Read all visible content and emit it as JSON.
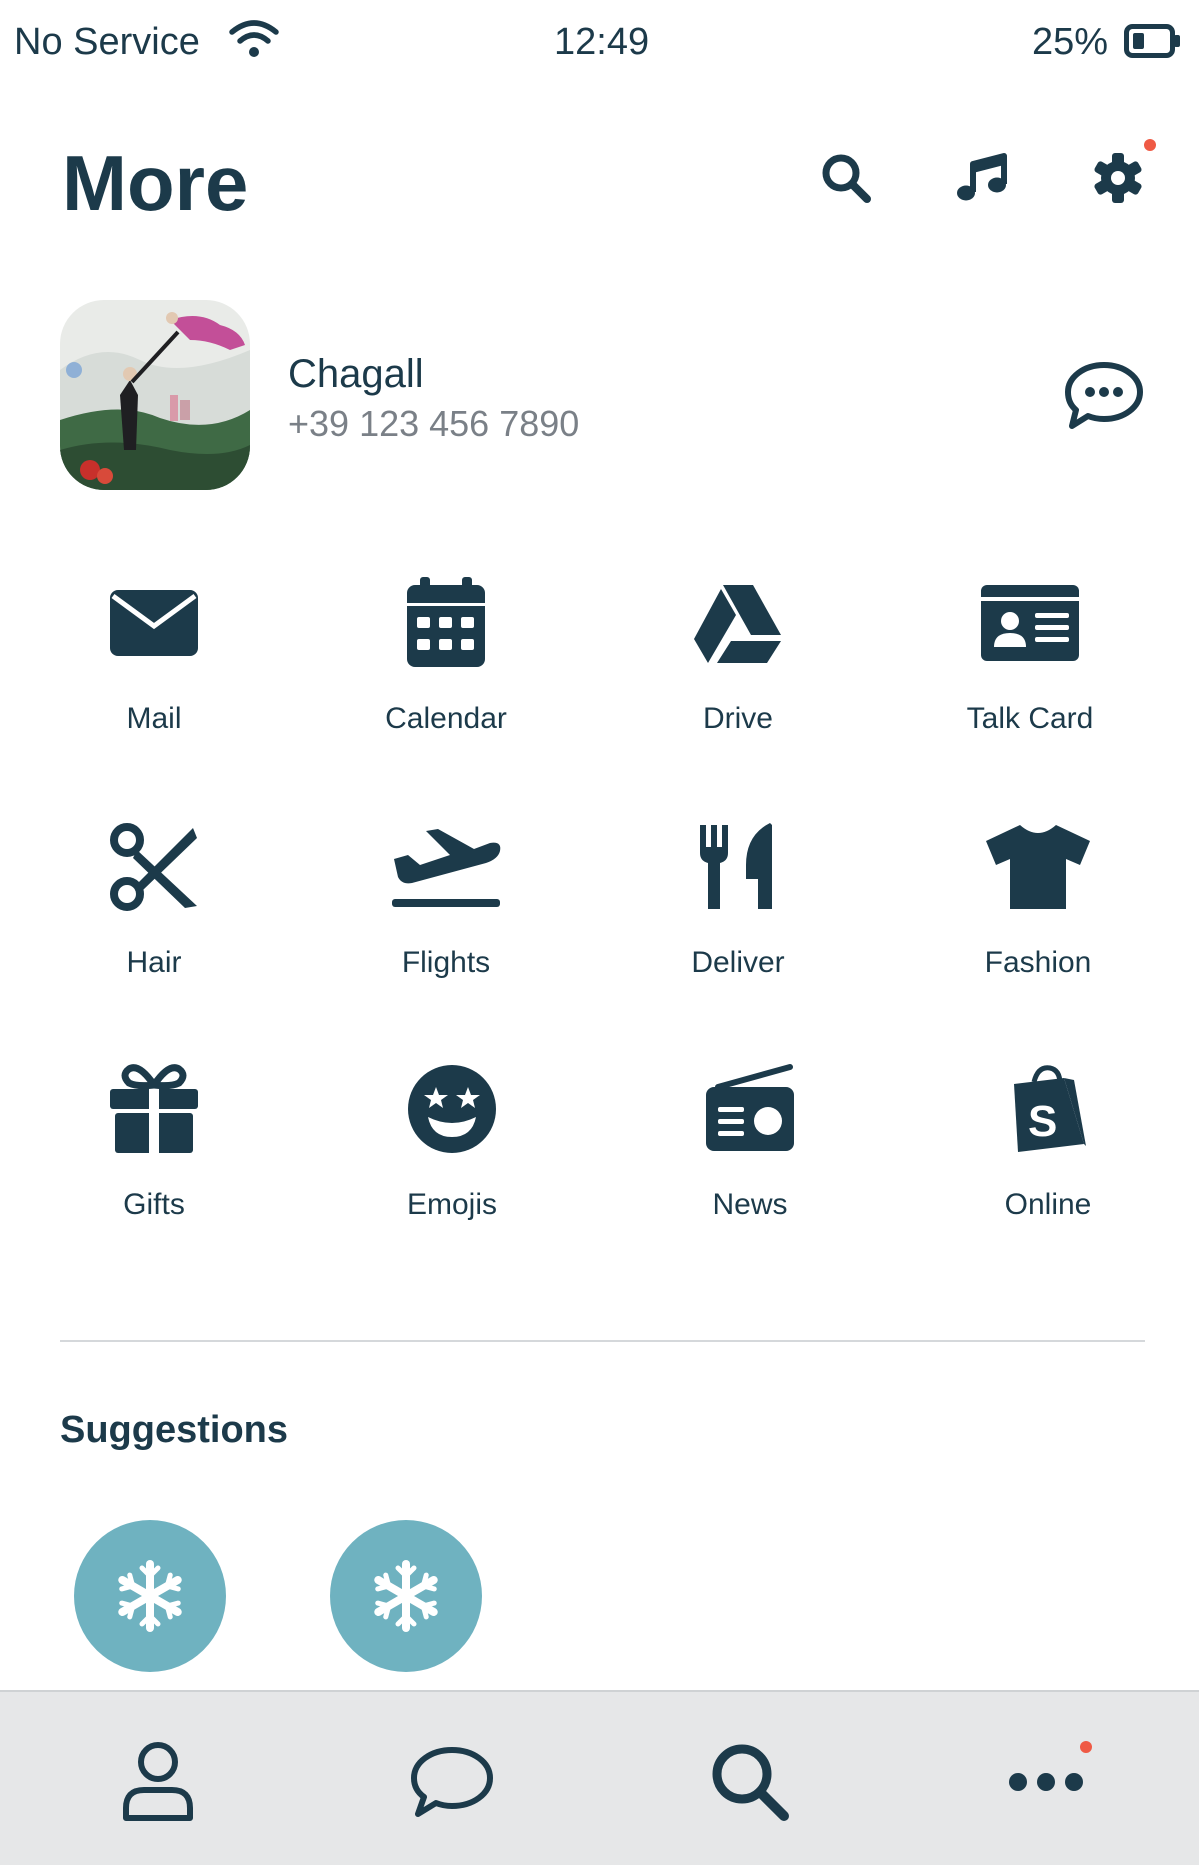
{
  "status_bar": {
    "carrier": "No Service",
    "time": "12:49",
    "battery": "25%"
  },
  "header": {
    "title": "More"
  },
  "profile": {
    "name": "Chagall",
    "phone": "+39 123 456 7890"
  },
  "apps": [
    {
      "label": "Mail",
      "icon": "envelope-icon"
    },
    {
      "label": "Calendar",
      "icon": "calendar-icon"
    },
    {
      "label": "Drive",
      "icon": "drive-icon"
    },
    {
      "label": "Talk Card",
      "icon": "id-card-icon"
    },
    {
      "label": "Hair",
      "icon": "scissors-icon"
    },
    {
      "label": "Flights",
      "icon": "plane-icon"
    },
    {
      "label": "Deliver",
      "icon": "utensils-icon"
    },
    {
      "label": "Fashion",
      "icon": "tshirt-icon"
    },
    {
      "label": "Gifts",
      "icon": "gift-icon"
    },
    {
      "label": "Emojis",
      "icon": "star-struck-emoji-icon"
    },
    {
      "label": "News",
      "icon": "radio-icon"
    },
    {
      "label": "Online",
      "icon": "shopify-bag-icon"
    }
  ],
  "suggestions": {
    "title": "Suggestions"
  },
  "colors": {
    "text": "#1c3a4a",
    "accent_dot": "#ef5a45",
    "suggestion_bg": "#6fb2c0",
    "nav_bg": "#e6e7e8"
  }
}
